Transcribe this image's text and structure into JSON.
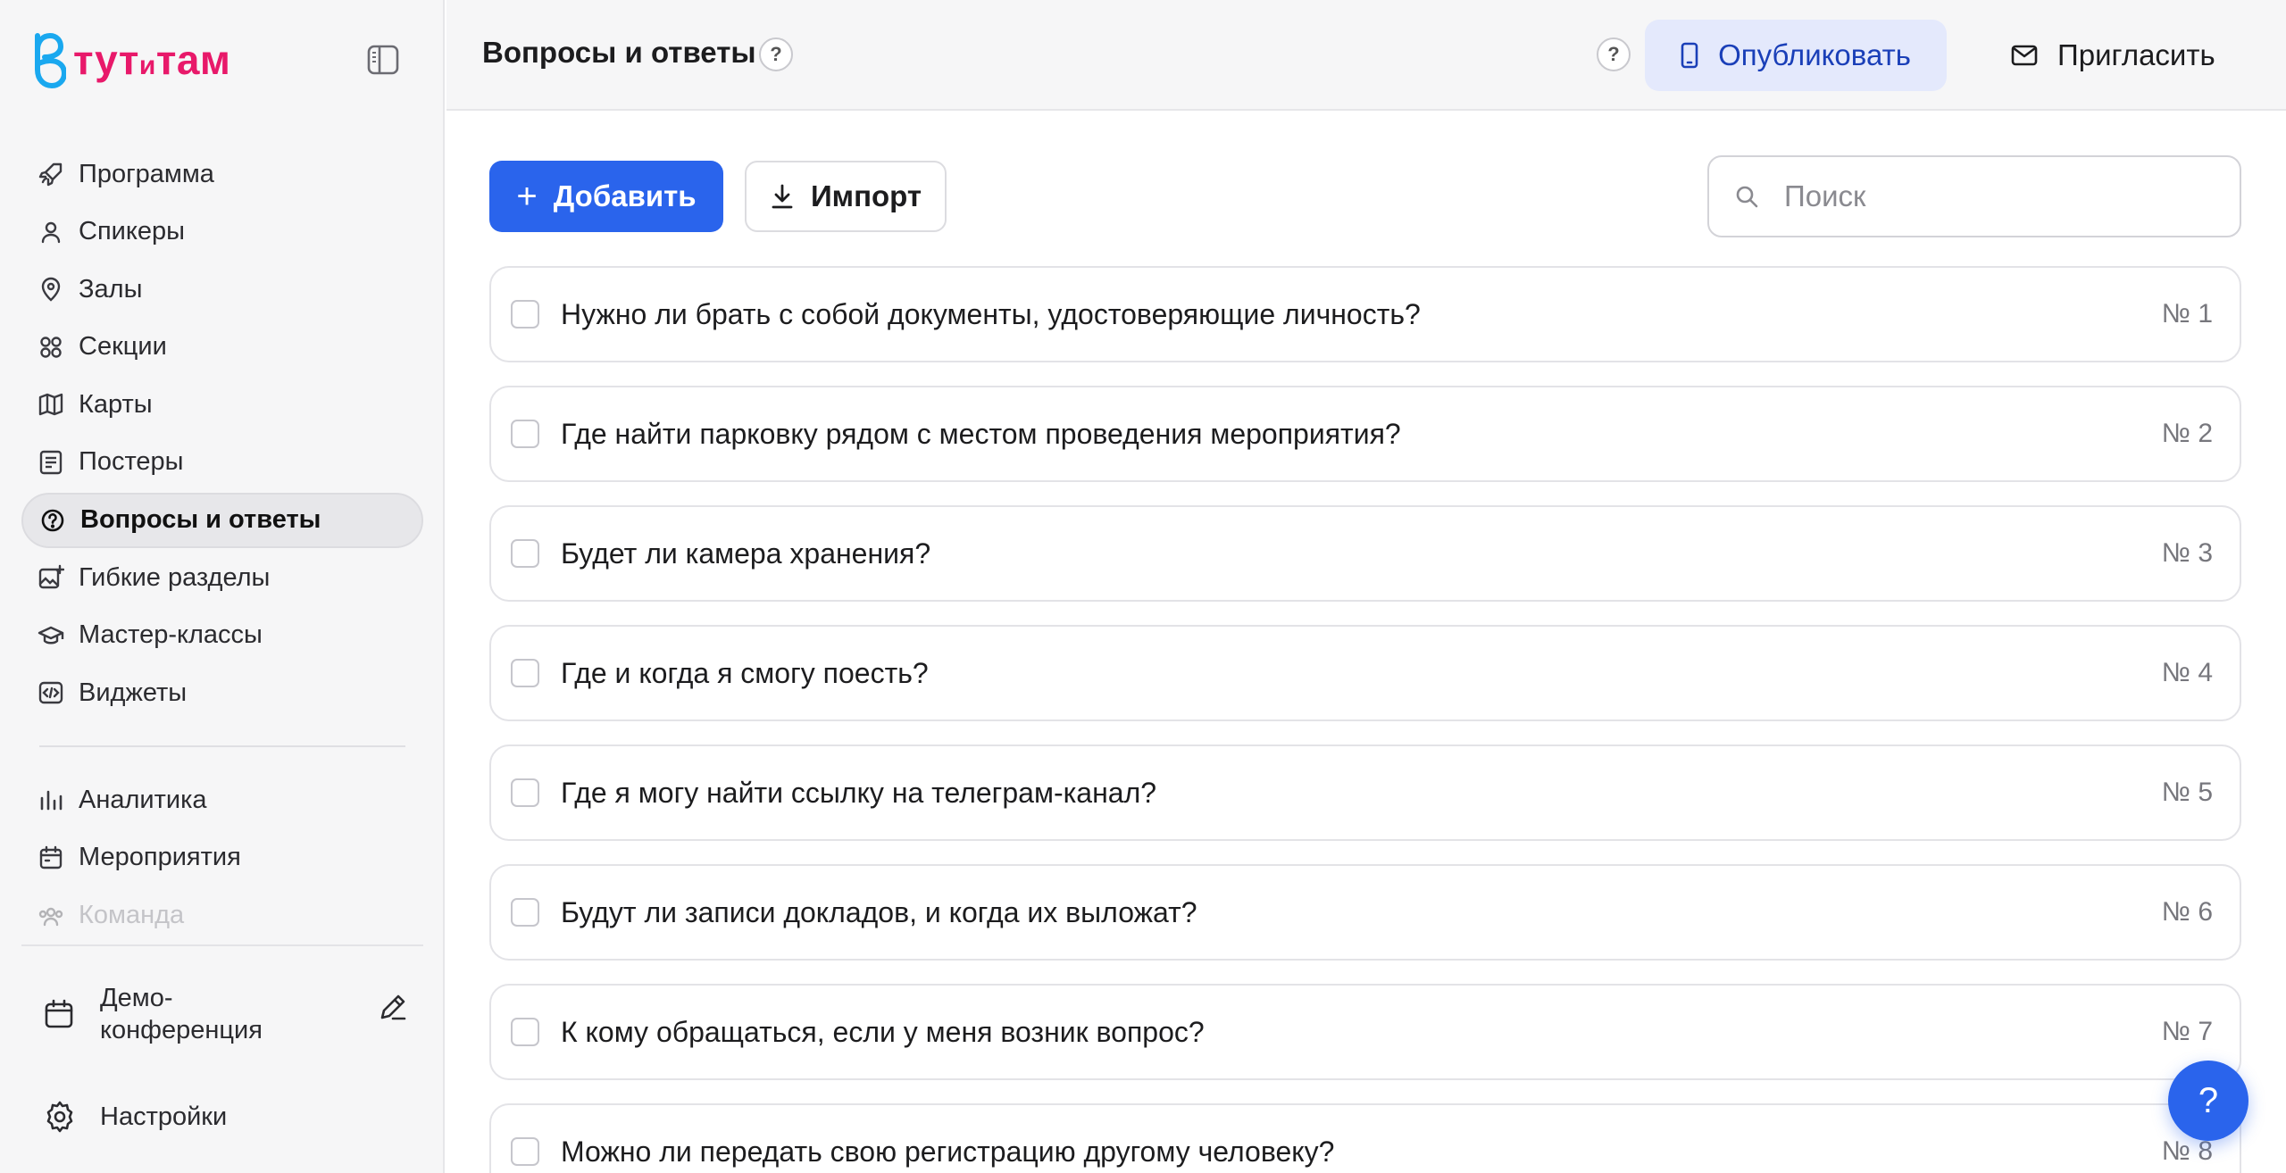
{
  "brand": {
    "name_left": "тут",
    "name_mid": "и",
    "name_right": "там",
    "color": "#e8196a",
    "mark_color": "#1aa8ef"
  },
  "sidebar": {
    "items": [
      {
        "label": "Программа",
        "icon": "rocket-icon"
      },
      {
        "label": "Спикеры",
        "icon": "user-icon"
      },
      {
        "label": "Залы",
        "icon": "map-pin-icon"
      },
      {
        "label": "Секции",
        "icon": "grid-icon"
      },
      {
        "label": "Карты",
        "icon": "map-icon"
      },
      {
        "label": "Постеры",
        "icon": "poster-icon"
      },
      {
        "label": "Вопросы и ответы",
        "icon": "help-circle-icon",
        "active": true
      },
      {
        "label": "Гибкие разделы",
        "icon": "image-plus-icon"
      },
      {
        "label": "Мастер-классы",
        "icon": "graduation-cap-icon"
      },
      {
        "label": "Виджеты",
        "icon": "code-icon"
      }
    ],
    "secondary": [
      {
        "label": "Аналитика",
        "icon": "bar-chart-icon"
      },
      {
        "label": "Мероприятия",
        "icon": "calendar-icon"
      },
      {
        "label": "Команда",
        "icon": "team-icon"
      }
    ],
    "event_name": "Демо-конференция",
    "settings_label": "Настройки"
  },
  "topbar": {
    "title": "Вопросы и ответы",
    "help_badge": "?",
    "publish_label": "Опубликовать",
    "invite_label": "Пригласить"
  },
  "toolbar": {
    "add_label": "Добавить",
    "add_plus": "+",
    "import_label": "Импорт",
    "search_placeholder": "Поиск"
  },
  "faq": [
    {
      "text": "Нужно ли брать с собой документы, удостоверяющие личность?",
      "num": "№ 1"
    },
    {
      "text": "Где найти парковку рядом с местом проведения мероприятия?",
      "num": "№ 2"
    },
    {
      "text": "Будет ли камера хранения?",
      "num": "№ 3"
    },
    {
      "text": "Где и когда я смогу поесть?",
      "num": "№ 4"
    },
    {
      "text": "Где я могу найти ссылку на телеграм-канал?",
      "num": "№ 5"
    },
    {
      "text": "Будут ли записи докладов, и когда их выложат?",
      "num": "№ 6"
    },
    {
      "text": "К кому обращаться, если у меня возник вопрос?",
      "num": "№ 7"
    },
    {
      "text": "Можно ли передать свою регистрацию другому человеку?",
      "num": "№ 8"
    }
  ],
  "help_fab": "?",
  "colors": {
    "accent": "#2a64ec",
    "publish_bg": "#e4e9fc",
    "publish_text": "#1a3fb8"
  }
}
